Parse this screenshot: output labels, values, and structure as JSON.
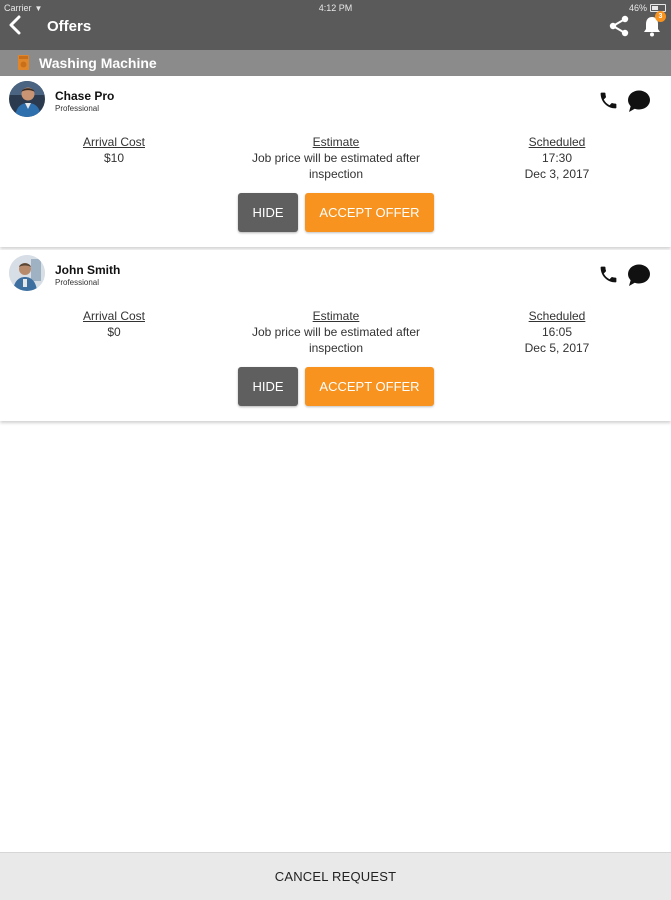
{
  "status_bar": {
    "carrier": "Carrier",
    "time": "4:12 PM",
    "battery": "46%"
  },
  "nav": {
    "title": "Offers",
    "back_icon": "chevron-left-icon",
    "share_icon": "share-icon",
    "bell_icon": "bell-icon",
    "notification_count": "3"
  },
  "category": {
    "label": "Washing Machine",
    "icon": "washing-machine-icon"
  },
  "offers": [
    {
      "name": "Chase Pro",
      "role": "Professional",
      "arrival_cost_label": "Arrival Cost",
      "arrival_cost": "$10",
      "estimate_label": "Estimate",
      "estimate_line1": "Job price will be estimated after",
      "estimate_line2": "inspection",
      "scheduled_label": "Scheduled",
      "scheduled_time": "17:30",
      "scheduled_date": "Dec 3, 2017",
      "hide_label": "HIDE",
      "accept_label": "ACCEPT OFFER"
    },
    {
      "name": "John Smith",
      "role": "Professional",
      "arrival_cost_label": "Arrival Cost",
      "arrival_cost": "$0",
      "estimate_label": "Estimate",
      "estimate_line1": "Job price will be estimated after",
      "estimate_line2": "inspection",
      "scheduled_label": "Scheduled",
      "scheduled_time": "16:05",
      "scheduled_date": "Dec 5, 2017",
      "hide_label": "HIDE",
      "accept_label": "ACCEPT OFFER"
    }
  ],
  "footer": {
    "cancel_label": "CANCEL REQUEST"
  },
  "colors": {
    "header": "#5a5a5a",
    "category_bar": "#8b8b8b",
    "accent_orange": "#f7931e",
    "hide_button": "#5f5f5f",
    "footer": "#e9e9e9"
  }
}
